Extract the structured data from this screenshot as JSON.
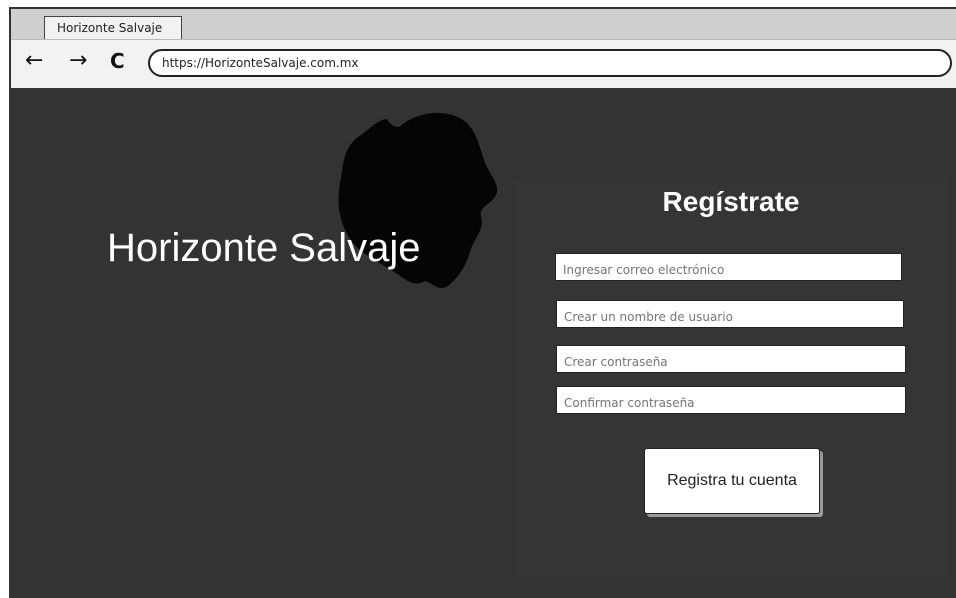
{
  "browser": {
    "tab_title": "Horizonte Salvaje",
    "url": "https://HorizonteSalvaje.com.mx",
    "icons": {
      "back": "arrow-left-icon",
      "forward": "arrow-right-icon",
      "reload": "reload-icon"
    }
  },
  "page": {
    "background_color": "#333333",
    "brand_name": "Horizonte Salvaje",
    "logo": "lion-silhouette-icon"
  },
  "register": {
    "title": "Regístrate",
    "fields": [
      {
        "placeholder": "Ingresar correo electrónico",
        "value": ""
      },
      {
        "placeholder": "Crear un nombre de usuario",
        "value": ""
      },
      {
        "placeholder": "Crear contraseña",
        "value": ""
      },
      {
        "placeholder": "Confirmar contraseña",
        "value": ""
      }
    ],
    "submit_label": "Registra tu cuenta"
  }
}
